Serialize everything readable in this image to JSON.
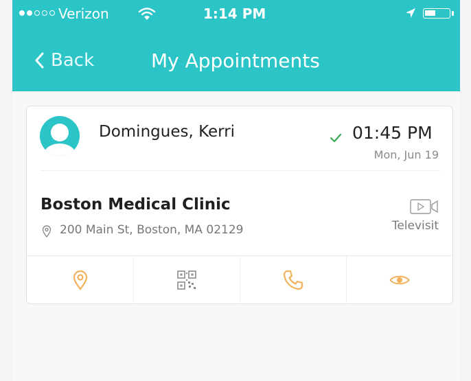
{
  "status_bar": {
    "carrier": "Verizon",
    "time": "1:14 PM"
  },
  "nav": {
    "back_label": "Back",
    "title": "My Appointments"
  },
  "appointment": {
    "patient_name": "Domingues, Kerri",
    "time": "01:45 PM",
    "date": "Mon, Jun 19",
    "clinic_name": "Boston Medical Clinic",
    "address": "200 Main St, Boston, MA 02129",
    "visit_type": "Televisit"
  },
  "icons": {
    "back": "chevron-left-icon",
    "wifi": "wifi-icon",
    "location_arrow": "location-arrow-icon",
    "battery": "battery-icon",
    "avatar": "user-avatar-icon",
    "check": "check-icon",
    "address_pin": "map-pin-icon",
    "video": "video-camera-icon",
    "actions": [
      "map-pin-icon",
      "qr-code-icon",
      "phone-icon",
      "eye-icon"
    ]
  },
  "colors": {
    "header": "#2bc4c7",
    "action_icon": "#f2b15a",
    "check": "#3aaa52",
    "avatar": "#2bc4c7"
  }
}
